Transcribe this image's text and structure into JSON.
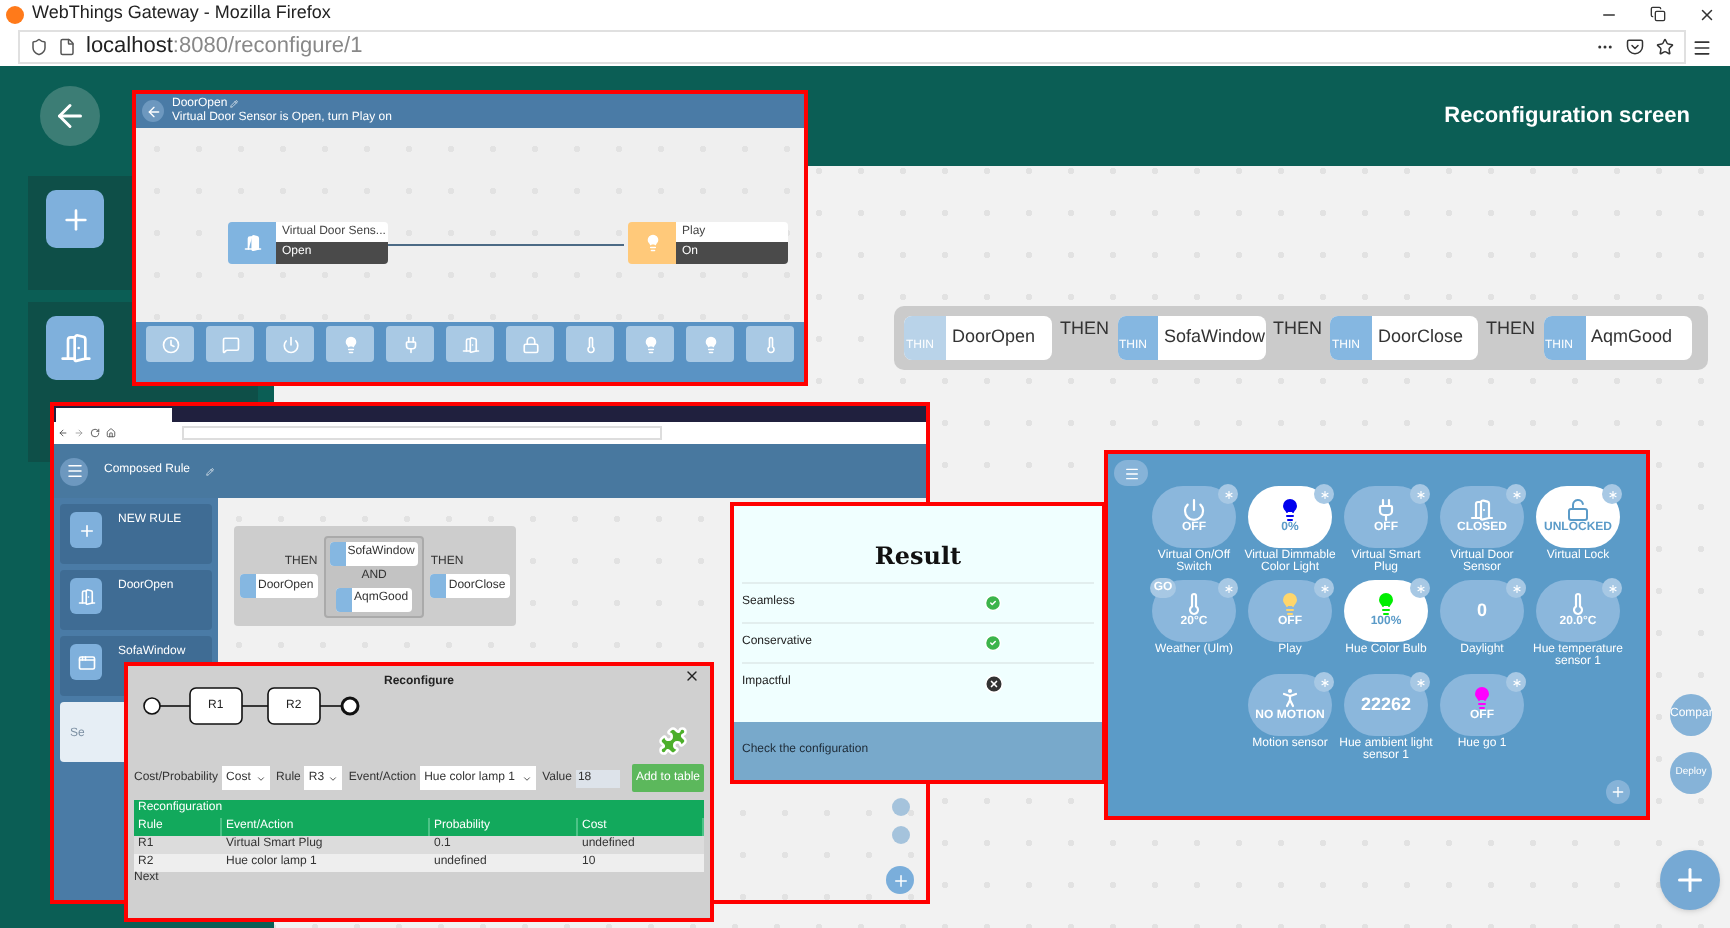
{
  "browser": {
    "title": "WebThings Gateway - Mozilla Firefox",
    "url_host": "localhost",
    "url_rest": ":8080/reconfigure/1"
  },
  "header": {
    "title": "Reconfiguration screen"
  },
  "rule_chain": {
    "items": [
      {
        "tag": "THIN",
        "name": "DoorOpen",
        "faded": true
      },
      {
        "tag": "THIN",
        "name": "SofaWindow",
        "faded": false
      },
      {
        "tag": "THIN",
        "name": "DoorClose",
        "faded": false
      },
      {
        "tag": "THIN",
        "name": "AqmGood",
        "faded": false
      }
    ],
    "connectors": [
      "THEN",
      "THEN",
      "THEN"
    ]
  },
  "rule_editor": {
    "title": "DoorOpen",
    "description": "Virtual Door Sensor is Open, turn Play on",
    "nodes": [
      {
        "kind": "door",
        "name": "Virtual Door Sens...",
        "value": "Open"
      },
      {
        "kind": "bulb",
        "name": "Play",
        "value": "On"
      }
    ],
    "palette": [
      {
        "kind": "clock"
      },
      {
        "kind": "message"
      },
      {
        "kind": "power"
      },
      {
        "kind": "bulb"
      },
      {
        "kind": "plug"
      },
      {
        "kind": "door"
      },
      {
        "kind": "lock"
      },
      {
        "kind": "thermo"
      },
      {
        "kind": "bulb"
      },
      {
        "kind": "bulb"
      },
      {
        "kind": "thermo"
      }
    ]
  },
  "composed_window": {
    "title": "Composed Rule",
    "sidebar": [
      {
        "kind": "plus",
        "label": "NEW RULE"
      },
      {
        "kind": "door",
        "label": "DoorOpen"
      },
      {
        "kind": "window",
        "label": "SofaWindow"
      },
      {
        "kind": "blank",
        "label": "Se"
      }
    ],
    "chain": {
      "first": "DoorOpen",
      "then_1": "THEN",
      "middle": [
        "SofaWindow",
        "AqmGood"
      ],
      "and": "AND",
      "then_2": "THEN",
      "last": "DoorClose"
    }
  },
  "reconfigure_dialog": {
    "title": "Reconfigure",
    "tasks": [
      "R1",
      "R2"
    ],
    "fields": [
      {
        "kind": "select",
        "label": "Cost/Probability",
        "value": "Cost"
      },
      {
        "kind": "select",
        "label": "Rule",
        "value": "R3"
      },
      {
        "kind": "select",
        "label": "Event/Action",
        "value": "Hue color lamp 1"
      },
      {
        "kind": "input",
        "label": "Value",
        "value": "18"
      }
    ],
    "add_button": "Add to table",
    "table_title": "Reconfiguration",
    "columns": [
      "Rule",
      "Event/Action",
      "Probability",
      "Cost"
    ],
    "rows": [
      [
        "R1",
        "Virtual Smart Plug",
        "0.1",
        "undefined"
      ],
      [
        "R2",
        "Hue color lamp 1",
        "undefined",
        "10"
      ]
    ],
    "footer": "Next"
  },
  "result": {
    "title": "Result",
    "rows": [
      {
        "label": "Seamless",
        "passed": true
      },
      {
        "label": "Conservative",
        "passed": true
      },
      {
        "label": "Impactful",
        "passed": false
      }
    ],
    "footer": "Check the configuration"
  },
  "things_panel": {
    "things": [
      {
        "kind": "power",
        "name": "Virtual On/Off Switch",
        "state": "OFF",
        "highlighted": false
      },
      {
        "kind": "bulb",
        "name": "Virtual Dimmable Color Light",
        "state": "0%",
        "highlighted": true,
        "color": "#0000ee"
      },
      {
        "kind": "plug",
        "name": "Virtual Smart Plug",
        "state": "OFF",
        "highlighted": false
      },
      {
        "kind": "door",
        "name": "Virtual Door Sensor",
        "state": "CLOSED",
        "highlighted": false
      },
      {
        "kind": "lock",
        "name": "Virtual Lock",
        "state": "UNLOCKED",
        "highlighted": true
      },
      {
        "kind": "thermo",
        "name": "Weather (Ulm)",
        "state": "20°C",
        "highlighted": false,
        "badge": "GO"
      },
      {
        "kind": "bulb",
        "name": "Play",
        "state": "OFF",
        "highlighted": false,
        "color": "#ffd66b"
      },
      {
        "kind": "bulb",
        "name": "Hue Color Bulb",
        "state": "100%",
        "highlighted": true,
        "color": "#00ee00"
      },
      {
        "kind": "number",
        "name": "Daylight",
        "state": "0",
        "highlighted": false
      },
      {
        "kind": "thermo",
        "name": "Hue temperature sensor 1",
        "state": "20.0°C",
        "highlighted": false
      },
      {
        "kind": "motion",
        "name": "Motion sensor",
        "state": "NO MOTION",
        "highlighted": false
      },
      {
        "kind": "number",
        "name": "Hue ambient light sensor 1",
        "state": "22262",
        "highlighted": false
      },
      {
        "kind": "bulb",
        "name": "Hue go 1",
        "state": "OFF",
        "highlighted": false,
        "color": "#ff00ff"
      }
    ]
  },
  "actions": [
    "Compar",
    "Deploy"
  ]
}
